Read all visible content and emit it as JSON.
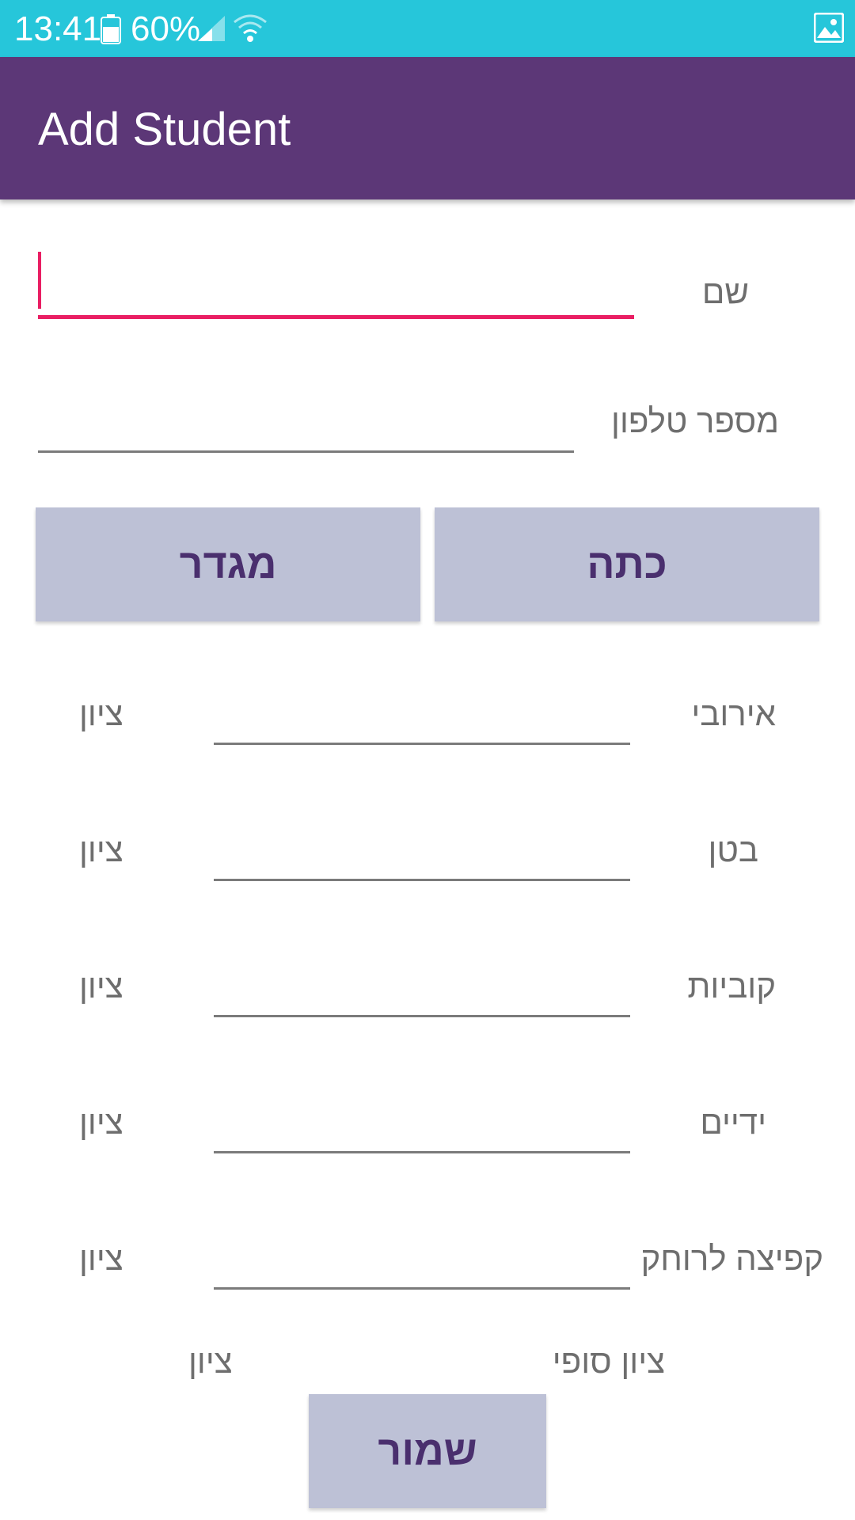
{
  "status_bar": {
    "time": "13:41",
    "battery": "60%",
    "icons": [
      "battery-icon",
      "signal-icon",
      "wifi-icon",
      "image-icon"
    ],
    "bg_color": "#26c6da"
  },
  "app_bar": {
    "title": "Add Student",
    "bg_color": "#5c3777"
  },
  "form": {
    "name_label": "שם",
    "name_value": "",
    "phone_label": "מספר טלפון",
    "phone_value": "",
    "class_button": "כתה",
    "gender_button": "מגדר",
    "grades": [
      {
        "label": "אירובי",
        "grade_label": "ציון",
        "value": ""
      },
      {
        "label": "בטן",
        "grade_label": "ציון",
        "value": ""
      },
      {
        "label": "קוביות",
        "grade_label": "ציון",
        "value": ""
      },
      {
        "label": "ידיים",
        "grade_label": "ציון",
        "value": ""
      },
      {
        "label": "קפיצה לרוחק",
        "grade_label": "ציון",
        "value": ""
      }
    ],
    "final_grade_label": "ציון סופי",
    "final_grade_value": "ציון",
    "save_button": "שמור"
  },
  "colors": {
    "accent": "#e91e63",
    "button_bg": "#bdc1d6",
    "button_text": "#4a2f6e"
  }
}
